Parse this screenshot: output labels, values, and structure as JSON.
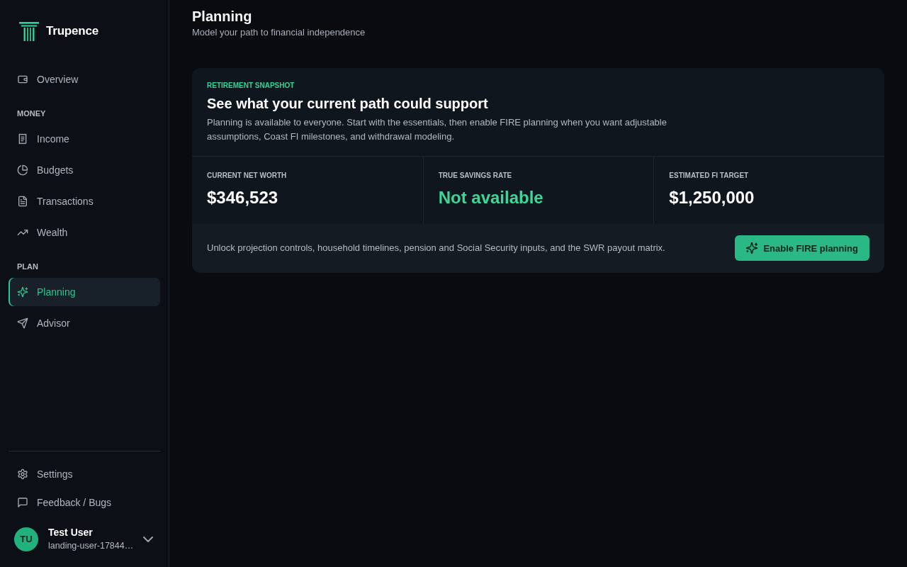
{
  "sidebar": {
    "brand": "Trupence",
    "sections": [
      {
        "items": [
          {
            "label": "Overview",
            "selected": false
          }
        ]
      },
      {
        "heading": "MONEY",
        "items": [
          {
            "label": "Income",
            "selected": false
          },
          {
            "label": "Budgets",
            "selected": false
          },
          {
            "label": "Transactions",
            "selected": false
          },
          {
            "label": "Wealth",
            "selected": false
          }
        ]
      },
      {
        "heading": "PLAN",
        "items": [
          {
            "label": "Planning",
            "selected": true
          },
          {
            "label": "Advisor",
            "selected": false
          }
        ]
      }
    ],
    "footer_items": [
      {
        "label": "Settings",
        "selected": false
      },
      {
        "label": "Feedback / Bugs",
        "selected": false
      }
    ],
    "user": {
      "initials": "TU",
      "name": "Test User",
      "email": "landing-user-17844…"
    }
  },
  "header": {
    "title": "Planning",
    "subtitle": "Model your path to financial independence"
  },
  "snapshot": {
    "eyebrow": "RETIREMENT SNAPSHOT",
    "title": "See what your current path could support",
    "description": "Planning is available to everyone. Start with the essentials, then enable FIRE planning when you want adjustable assumptions, Coast FI milestones, and withdrawal modeling.",
    "stats": [
      {
        "label": "CURRENT NET WORTH",
        "value": "$346,523",
        "kind": "amount"
      },
      {
        "label": "TRUE SAVINGS RATE",
        "value": "Not available",
        "kind": "status"
      },
      {
        "label": "ESTIMATED FI TARGET",
        "value": "$1,250,000",
        "kind": "amount"
      }
    ],
    "footer_text": "Unlock projection controls, household timelines, pension and Social Security inputs, and the SWR payout matrix.",
    "button": "Enable FIRE planning"
  }
}
